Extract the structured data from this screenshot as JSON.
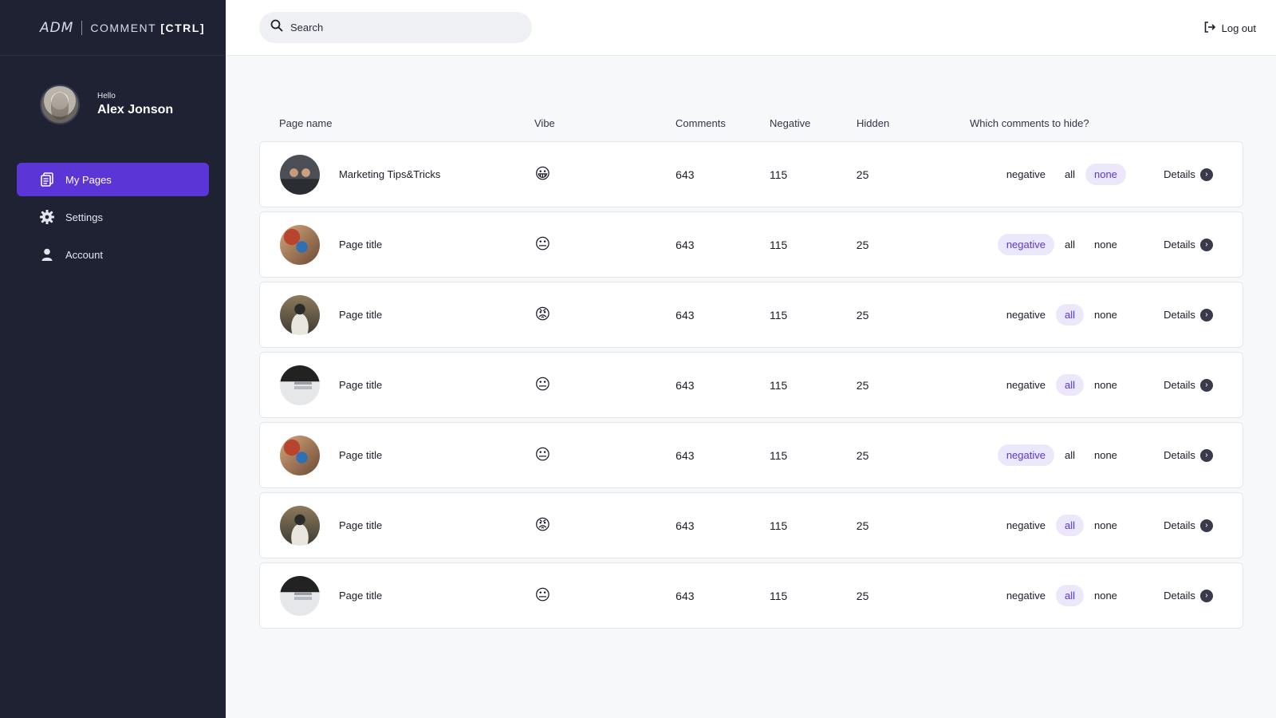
{
  "brand": {
    "logo": "ADM",
    "name_prefix": "COMMENT",
    "name_bold": "[CTRL]"
  },
  "user": {
    "greeting": "Hello",
    "name": "Alex Jonson"
  },
  "nav": {
    "items": [
      {
        "label": "My Pages",
        "icon": "pages-icon",
        "active": true
      },
      {
        "label": "Settings",
        "icon": "gear-icon",
        "active": false
      },
      {
        "label": "Account",
        "icon": "user-icon",
        "active": false
      }
    ]
  },
  "search": {
    "placeholder": "Search"
  },
  "header": {
    "logout_label": "Log out"
  },
  "table": {
    "columns": {
      "page_name": "Page name",
      "vibe": "Vibe",
      "comments": "Comments",
      "negative": "Negative",
      "hidden": "Hidden",
      "hide": "Which comments to hide?"
    },
    "options": {
      "negative": "negative",
      "all": "all",
      "none": "none"
    },
    "details_label": "Details",
    "rows": [
      {
        "title": "Marketing Tips&Tricks",
        "vibe": "😀",
        "comments": "643",
        "negative": "115",
        "hidden": "25",
        "selected": "none"
      },
      {
        "title": "Page title",
        "vibe": "😐",
        "comments": "643",
        "negative": "115",
        "hidden": "25",
        "selected": "negative"
      },
      {
        "title": "Page title",
        "vibe": "😡",
        "comments": "643",
        "negative": "115",
        "hidden": "25",
        "selected": "all"
      },
      {
        "title": "Page title",
        "vibe": "😐",
        "comments": "643",
        "negative": "115",
        "hidden": "25",
        "selected": "all"
      },
      {
        "title": "Page title",
        "vibe": "😐",
        "comments": "643",
        "negative": "115",
        "hidden": "25",
        "selected": "negative"
      },
      {
        "title": "Page title",
        "vibe": "😡",
        "comments": "643",
        "negative": "115",
        "hidden": "25",
        "selected": "all"
      },
      {
        "title": "Page title",
        "vibe": "😐",
        "comments": "643",
        "negative": "115",
        "hidden": "25",
        "selected": "all"
      }
    ]
  },
  "colors": {
    "sidebar": "#1e2233",
    "accent": "#5b35d5",
    "pill_selected_bg": "#ece8fb"
  }
}
